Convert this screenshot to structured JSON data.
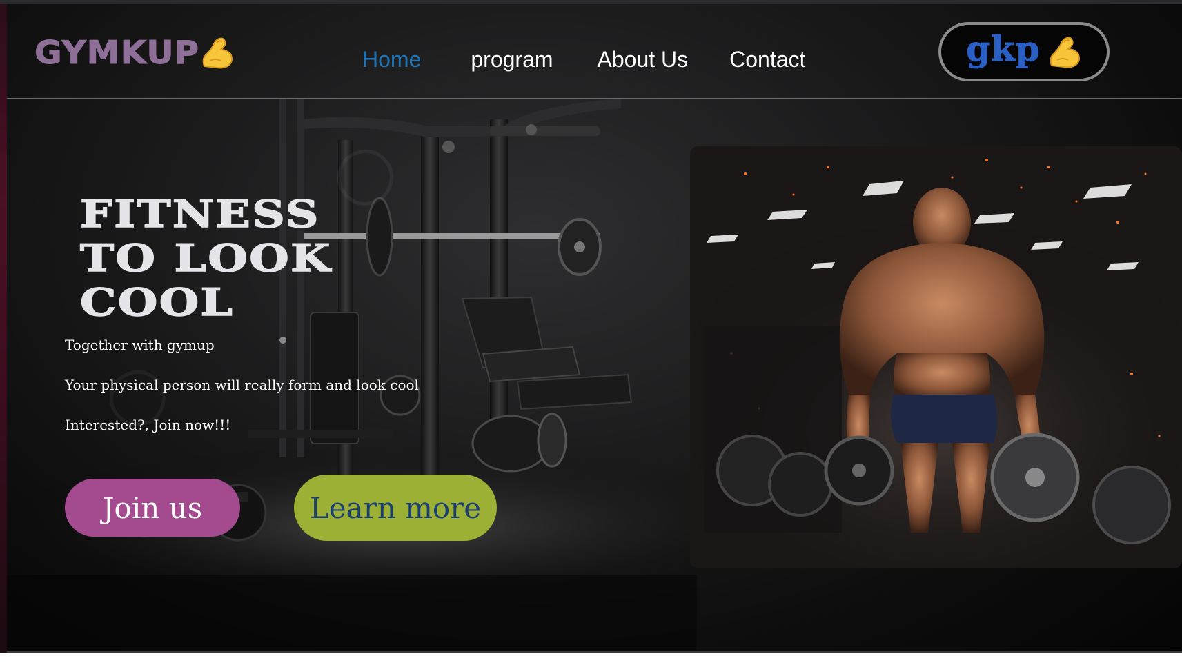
{
  "brand": {
    "logo_text": "GYMKUP",
    "logo_icon": "flexed-biceps-icon",
    "badge_text": "gkp",
    "badge_icon": "flexed-biceps-icon"
  },
  "nav": {
    "items": [
      {
        "label": "Home",
        "active": true
      },
      {
        "label": "program",
        "active": false
      },
      {
        "label": "About Us",
        "active": false
      },
      {
        "label": "Contact",
        "active": false
      }
    ],
    "active_color": "#1f74b8"
  },
  "hero": {
    "title_lines": [
      "FITNESS",
      "TO LOOK",
      "COOL"
    ],
    "lines": [
      "Together with gymup",
      "Your physical person will really form and look cool",
      "Interested?, Join now!!!"
    ],
    "buttons": {
      "join": "Join us",
      "learn": "Learn more"
    },
    "image": "bodybuilder-with-weight-plates"
  },
  "colors": {
    "logo": "#8e6f98",
    "badge_text": "#2a5fc4",
    "join_button": "#a44b90",
    "learn_button": "#9bb035",
    "learn_text": "#1c3f6e",
    "title": "#e4e4e9"
  }
}
